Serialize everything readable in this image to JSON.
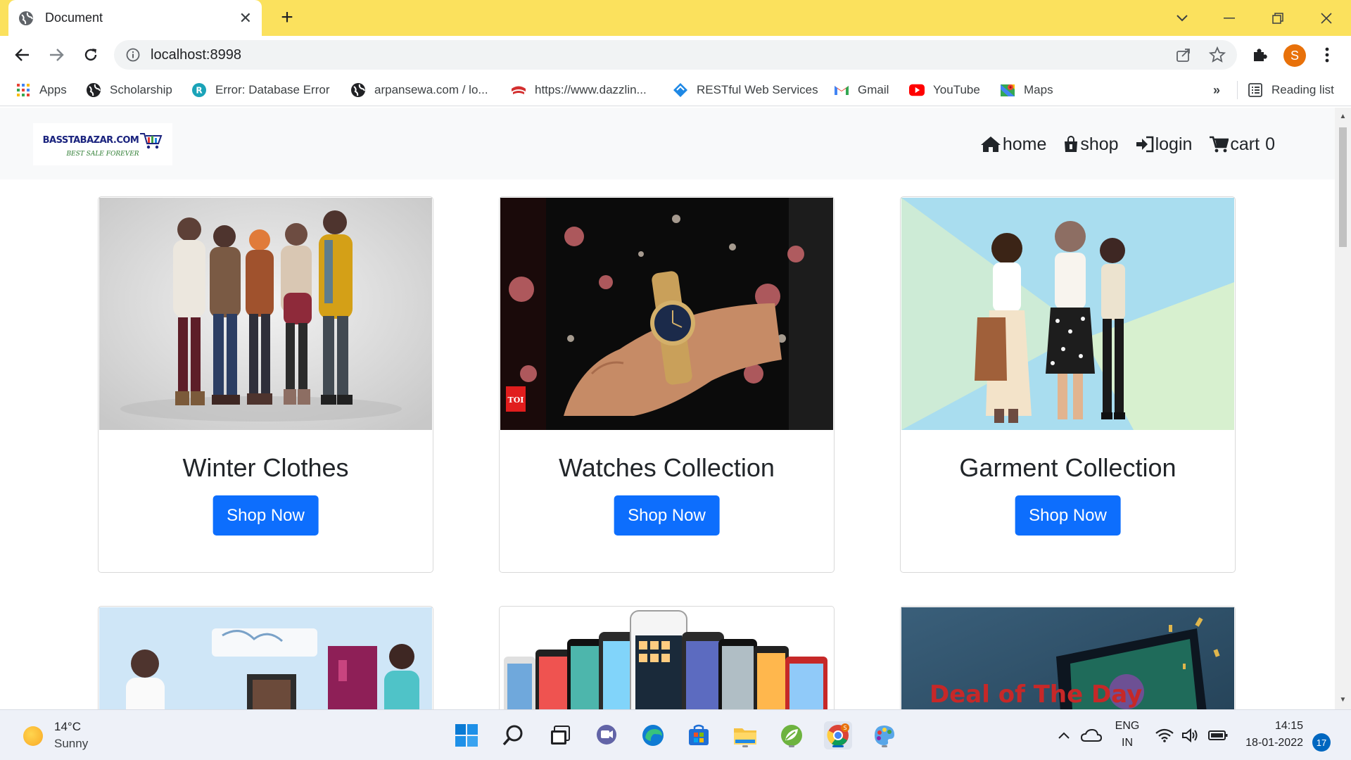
{
  "browser": {
    "tab_title": "Document",
    "url": "localhost:8998",
    "profile_initial": "S",
    "bookmarks": [
      {
        "label": "Apps",
        "icon": "apps-grid-icon"
      },
      {
        "label": "Scholarship",
        "icon": "globe-icon"
      },
      {
        "label": "Error: Database Error",
        "icon": "wordpress-icon"
      },
      {
        "label": "arpansewa.com / lo...",
        "icon": "globe-icon"
      },
      {
        "label": "https://www.dazzlin...",
        "icon": "dazzling-icon"
      },
      {
        "label": "RESTful Web Services",
        "icon": "diamond-icon"
      },
      {
        "label": "Gmail",
        "icon": "gmail-icon"
      },
      {
        "label": "YouTube",
        "icon": "youtube-icon"
      },
      {
        "label": "Maps",
        "icon": "maps-icon"
      }
    ],
    "overflow_label": "»",
    "reading_list": "Reading list"
  },
  "site": {
    "logo_main": "BASSTABAZAR.COM",
    "logo_tagline": "BEST SALE FOREVER",
    "nav": {
      "home": "home",
      "shop": "shop",
      "login": "login",
      "cart": "cart",
      "cart_count": "0"
    },
    "cards": [
      {
        "title": "Winter Clothes",
        "button": "Shop Now"
      },
      {
        "title": "Watches Collection",
        "button": "Shop Now",
        "badge": "TOI"
      },
      {
        "title": "Garment Collection",
        "button": "Shop Now"
      }
    ],
    "second_row_banner_text": "Deal of The Day"
  },
  "taskbar": {
    "temperature": "14°C",
    "condition": "Sunny",
    "lang_top": "ENG",
    "lang_bottom": "IN",
    "time": "14:15",
    "date": "18-01-2022",
    "notification_count": "17"
  },
  "colors": {
    "tabstrip": "#fbe15d",
    "primary_button": "#0d6efd",
    "profile_avatar": "#e8710a"
  }
}
